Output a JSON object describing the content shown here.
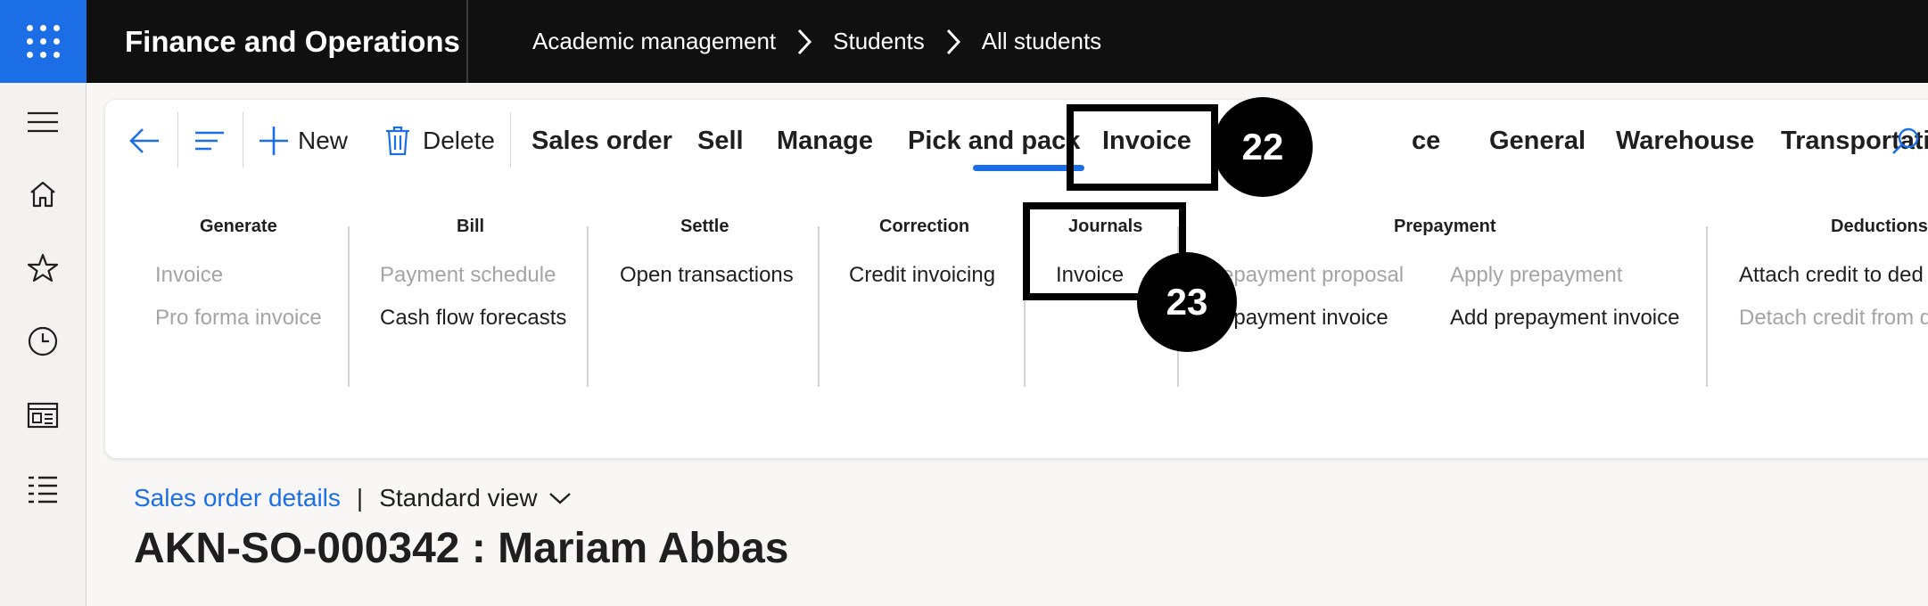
{
  "topbar": {
    "app_title": "Finance and Operations",
    "breadcrumb": [
      "Academic management",
      "Students",
      "All students"
    ],
    "colors": {
      "background": "#101010",
      "waffle": "#1c6ee6"
    }
  },
  "leftrail": {
    "icons": [
      "hamburger-icon",
      "home-icon",
      "star-icon",
      "clock-icon",
      "workspace-icon",
      "list-icon"
    ]
  },
  "toolbar": {
    "new_label": "New",
    "delete_label": "Delete",
    "tabs": [
      "Sales order",
      "Sell",
      "Manage",
      "Pick and pack",
      "Invoice",
      "ce",
      "General",
      "Warehouse",
      "Transportation"
    ],
    "selected_tab": "Invoice"
  },
  "ribbon": {
    "groups": [
      {
        "title": "Generate",
        "items": [
          {
            "label": "Invoice",
            "enabled": false
          },
          {
            "label": "Pro forma invoice",
            "enabled": false
          }
        ]
      },
      {
        "title": "Bill",
        "items": [
          {
            "label": "Payment schedule",
            "enabled": false
          },
          {
            "label": "Cash flow forecasts",
            "enabled": true
          }
        ]
      },
      {
        "title": "Settle",
        "items": [
          {
            "label": "Open transactions",
            "enabled": true
          }
        ]
      },
      {
        "title": "Correction",
        "items": [
          {
            "label": "Credit invoicing",
            "enabled": true
          }
        ]
      },
      {
        "title": "Journals",
        "items": [
          {
            "label": "Invoice",
            "enabled": true
          }
        ]
      },
      {
        "title": "Prepayment",
        "items": [
          {
            "label": "epayment proposal",
            "enabled": false
          },
          {
            "label": "Apply prepayment",
            "enabled": false
          },
          {
            "label": "epayment invoice",
            "enabled": true
          },
          {
            "label": "Add prepayment invoice",
            "enabled": true
          }
        ]
      },
      {
        "title": "Deductions",
        "items": [
          {
            "label": "Attach credit to ded",
            "enabled": true
          },
          {
            "label": "Detach credit from d",
            "enabled": false
          }
        ]
      }
    ]
  },
  "annotations": {
    "step_a": "22",
    "step_b": "23"
  },
  "page": {
    "details_link": "Sales order details",
    "separator": "|",
    "view": "Standard view",
    "title": "AKN-SO-000342 : Mariam Abbas"
  }
}
